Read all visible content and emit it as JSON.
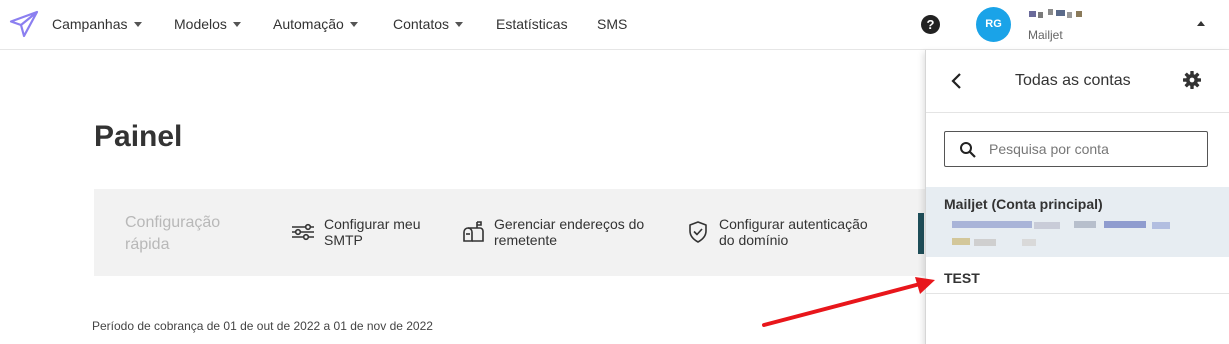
{
  "nav": {
    "items": [
      {
        "label": "Campanhas",
        "has_dropdown": true
      },
      {
        "label": "Modelos",
        "has_dropdown": true
      },
      {
        "label": "Automação",
        "has_dropdown": true
      },
      {
        "label": "Contatos",
        "has_dropdown": true
      },
      {
        "label": "Estatísticas",
        "has_dropdown": false
      },
      {
        "label": "SMS",
        "has_dropdown": false
      }
    ],
    "help_icon": "question-circle-icon",
    "help_glyph": "?",
    "avatar_initials": "RG",
    "account_subname": "Mailjet",
    "account_menu_state": "expanded"
  },
  "page": {
    "title": "Painel",
    "quick_setup": {
      "label_line1": "Configuração",
      "label_line2": "rápida",
      "items": [
        {
          "line1": "Configurar meu",
          "line2": "SMTP",
          "icon": "sliders-icon"
        },
        {
          "line1": "Gerenciar endereços do",
          "line2": "remetente",
          "icon": "mailbox-icon"
        },
        {
          "line1": "Configurar autenticação",
          "line2": "do domínio",
          "icon": "shield-check-icon"
        }
      ]
    },
    "billing_period": "Período de cobrança de 01 de out de 2022 a 01 de nov de 2022"
  },
  "account_panel": {
    "title": "Todas as contas",
    "back_icon": "chevron-left-icon",
    "settings_icon": "gear-icon",
    "search": {
      "placeholder": "Pesquisa por conta",
      "value": ""
    },
    "accounts": [
      {
        "label": "Mailjet (Conta principal)",
        "selected": true
      },
      {
        "label": "TEST",
        "selected": false
      }
    ]
  },
  "colors": {
    "brand_purple": "#8b7ff0",
    "avatar_blue": "#1aa3e8",
    "selected_row": "#e7edf2",
    "annotation_arrow": "#e8161b"
  }
}
